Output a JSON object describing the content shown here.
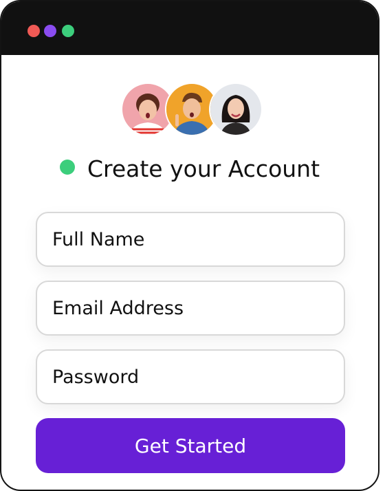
{
  "colors": {
    "titlebar": "#111111",
    "dot_red": "#f05a55",
    "dot_purple": "#8a4cf0",
    "dot_green": "#3cce7c",
    "status_green": "#3cce7c",
    "button_bg": "#6720d6",
    "avatar1_bg": "#f0a4ab",
    "avatar2_bg": "#f0a32a",
    "avatar3_bg": "#e4e7ec"
  },
  "window": {
    "controls": [
      "close-dot",
      "minimize-dot",
      "maximize-dot"
    ]
  },
  "avatars": [
    "woman-surprised-avatar",
    "man-pointing-avatar",
    "woman-smiling-avatar"
  ],
  "form": {
    "heading": "Create your Account",
    "fields": [
      {
        "placeholder": "Full Name",
        "value": ""
      },
      {
        "placeholder": "Email Address",
        "value": ""
      },
      {
        "placeholder": "Password",
        "value": ""
      }
    ],
    "submit_label": "Get Started"
  }
}
